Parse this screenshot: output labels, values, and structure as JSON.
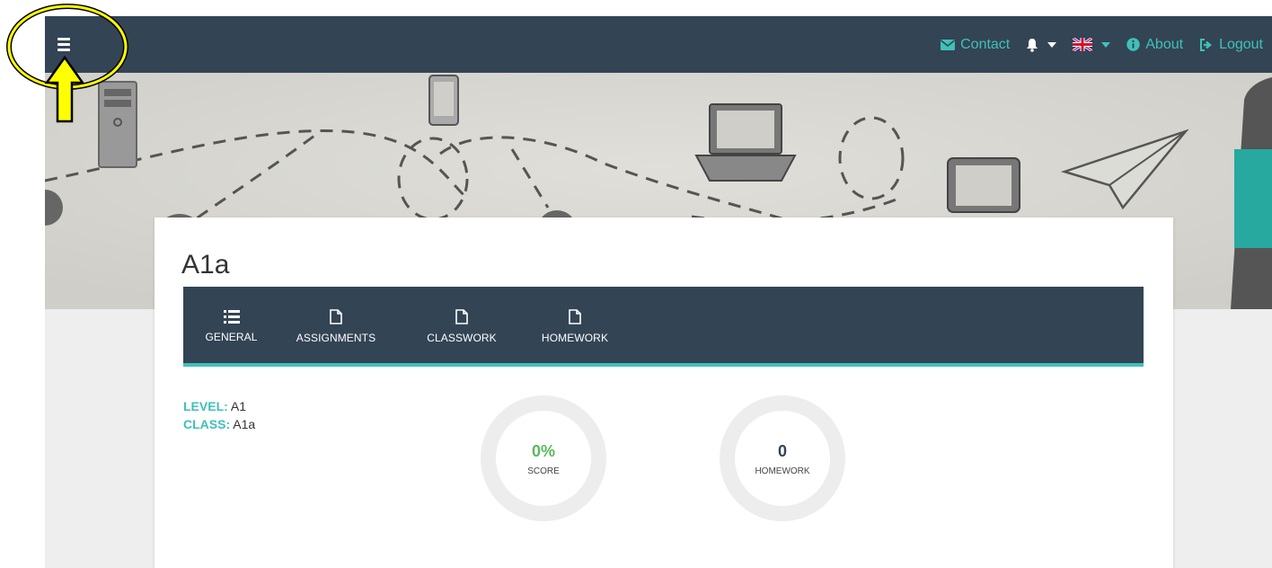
{
  "navbar": {
    "menu_icon": "hamburger-icon",
    "links": [
      {
        "label": "Contact",
        "icon": "envelope-icon"
      },
      {
        "label": "About",
        "icon": "info-circle-icon"
      },
      {
        "label": "Logout",
        "icon": "sign-out-icon"
      }
    ],
    "notifications_icon": "bell-icon",
    "language_icon": "uk-flag-icon"
  },
  "card": {
    "title": "A1a",
    "tabs": [
      {
        "label": "GENERAL",
        "icon": "list-icon",
        "active": true
      },
      {
        "label": "ASSIGNMENTS",
        "icon": "file-icon",
        "active": false
      },
      {
        "label": "CLASSWORK",
        "icon": "file-icon",
        "active": false
      },
      {
        "label": "HOMEWORK",
        "icon": "file-icon",
        "active": false
      }
    ],
    "info": {
      "level_key": "LEVEL:",
      "level_value": "A1",
      "class_key": "CLASS:",
      "class_value": "A1a"
    },
    "stats": {
      "score": {
        "value": "0%",
        "label": "SCORE",
        "color": "#5cb85c"
      },
      "homework": {
        "value": "0",
        "label": "HOMEWORK",
        "color": "#334455"
      }
    }
  },
  "colors": {
    "navbar": "#334455",
    "accent": "#3fc1b8",
    "annotation": "#ffff00"
  }
}
